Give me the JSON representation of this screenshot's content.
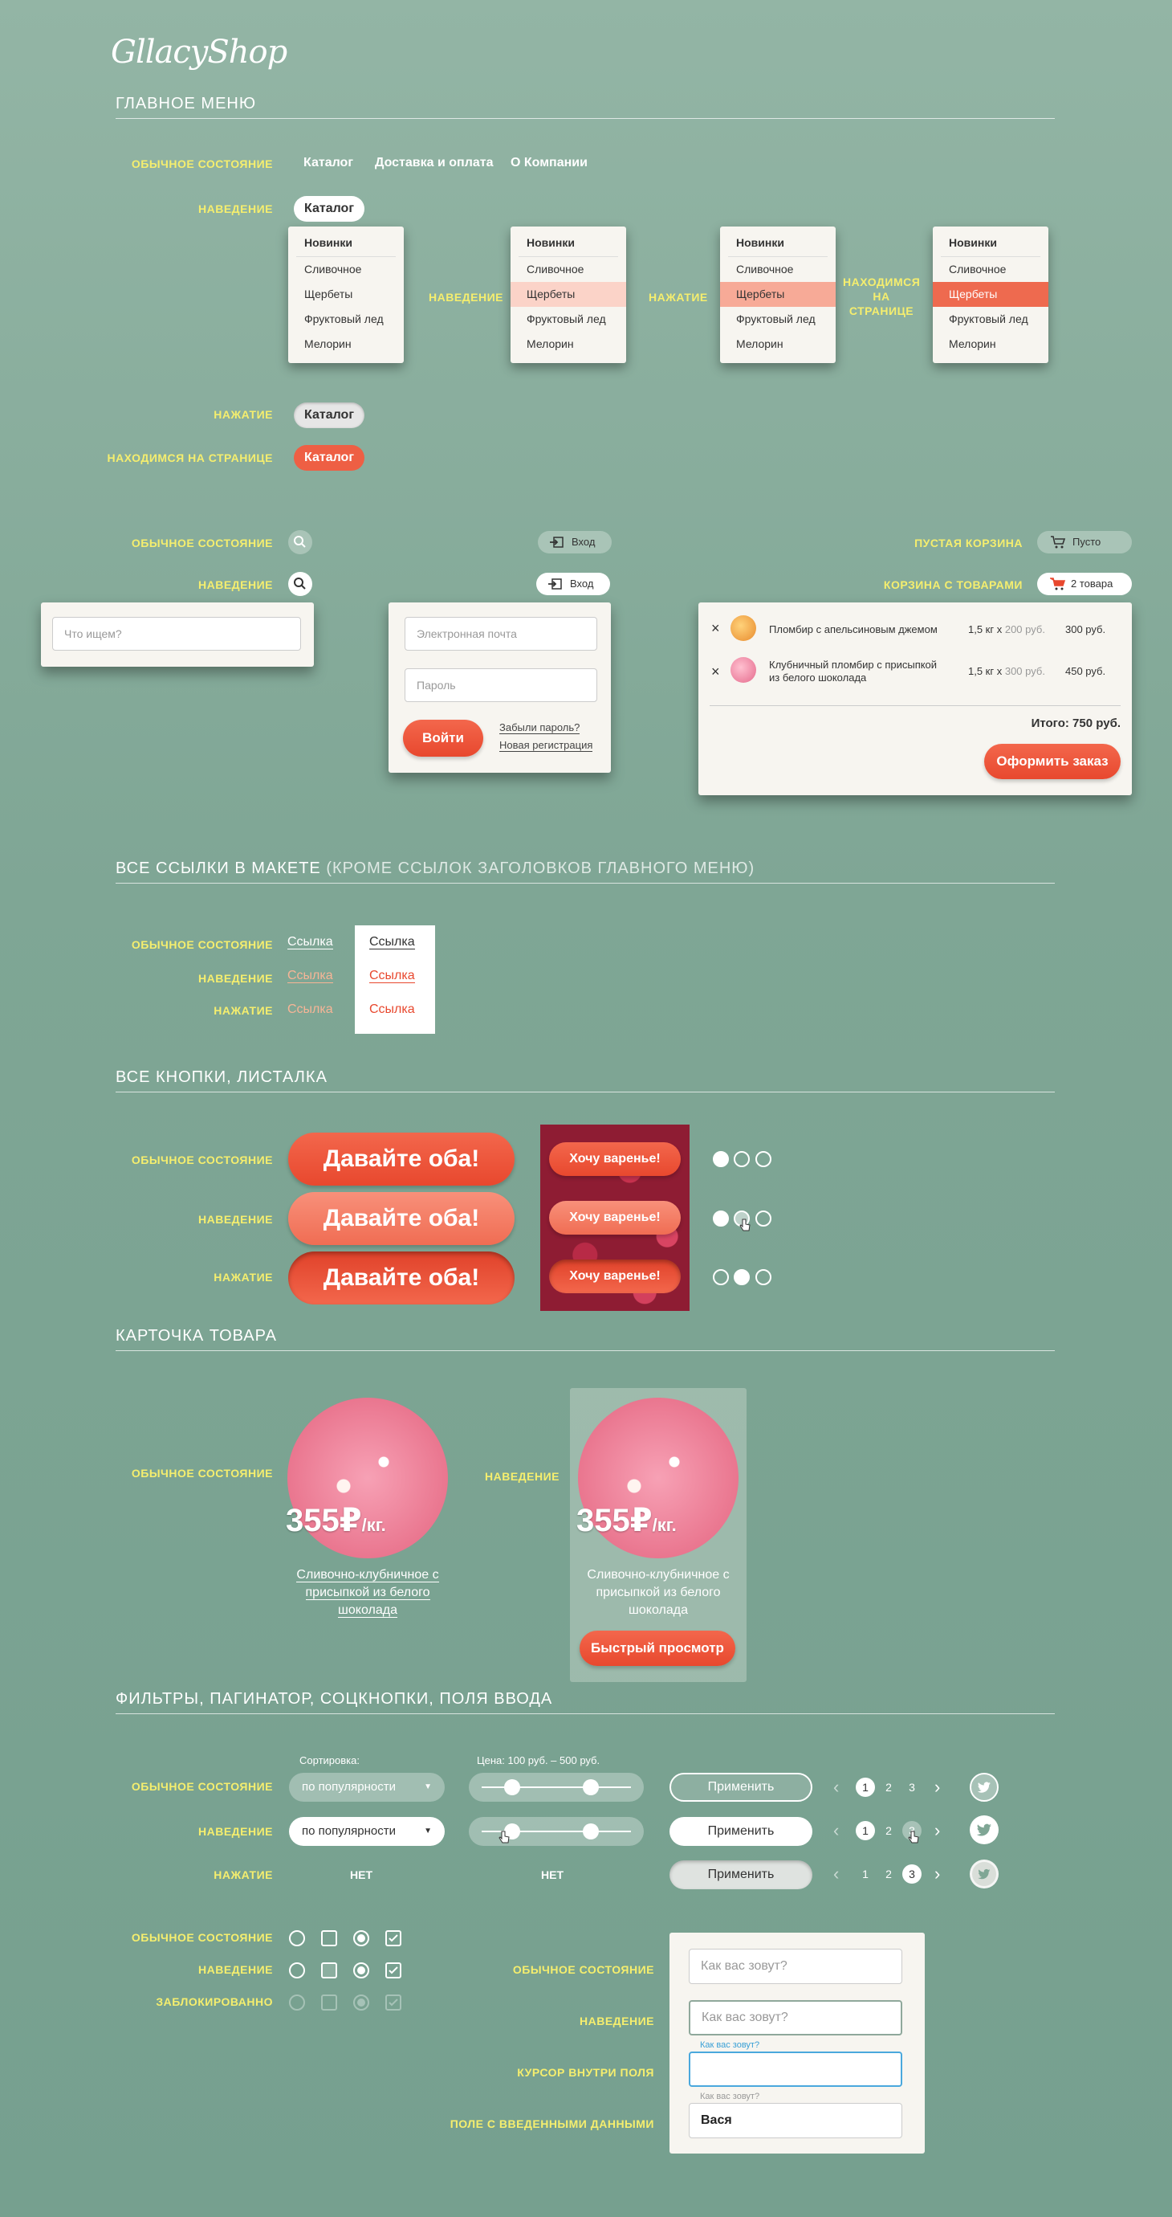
{
  "logo": "GllacyShop",
  "sections": {
    "main_menu": "ГЛАВНОЕ МЕНЮ",
    "links_main": "ВСЕ ССЫЛКИ В МАКЕТЕ",
    "links_sub": "(КРОМЕ ССЫЛОК ЗАГОЛОВКОВ ГЛАВНОГО МЕНЮ)",
    "buttons": "ВСЕ КНОПКИ, ЛИСТАЛКА",
    "card": "КАРТОЧКА ТОВАРА",
    "filters": "ФИЛЬТРЫ, ПАГИНАТОР, СОЦКНОПКИ, ПОЛЯ ВВОДА"
  },
  "states": {
    "normal": "ОБЫЧНОЕ СОСТОЯНИЕ",
    "hover": "НАВЕДЕНИЕ",
    "press": "НАЖАТИЕ",
    "current": "НАХОДИМСЯ НА СТРАНИЦЕ",
    "current_multiline": [
      "НАХОДИМСЯ",
      "НА",
      "СТРАНИЦЕ"
    ],
    "disabled": "ЗАБЛОКИРОВАННО",
    "cursor_in": "КУРСОР ВНУТРИ ПОЛЯ",
    "filled": "ПОЛЕ С ВВЕДЕННЫМИ ДАННЫМИ",
    "empty_cart": "ПУСТАЯ КОРЗИНА",
    "cart_with_items": "КОРЗИНА С ТОВАРАМИ",
    "none": "НЕТ"
  },
  "nav": {
    "catalog": "Каталог",
    "delivery": "Доставка и оплата",
    "about": "О Компании"
  },
  "dropdown": {
    "head": "Новинки",
    "items": [
      "Сливочное",
      "Щербеты",
      "Фруктовый лед",
      "Мелорин"
    ]
  },
  "search": {
    "placeholder": "Что ищем?"
  },
  "login": {
    "label": "Вход",
    "email": "Электронная почта",
    "password": "Пароль",
    "submit": "Войти",
    "forgot": "Забыли пароль?",
    "register": "Новая регистрация"
  },
  "cart": {
    "empty": "Пусто",
    "full": "2 товара",
    "items": [
      {
        "name": "Пломбир с апельсиновым джемом",
        "qty": "1,5 кг х ",
        "unit": "200 руб.",
        "sum": "300 руб."
      },
      {
        "name_l1": "Клубничный пломбир с присыпкой",
        "name_l2": "из белого шоколада",
        "qty": "1,5 кг х ",
        "unit": "300 руб.",
        "sum": "450 руб."
      }
    ],
    "total": "Итого: 750 руб.",
    "checkout": "Оформить заказ",
    "remove": "×"
  },
  "links": {
    "text": "Ссылка"
  },
  "buttons": {
    "big": "Давайте оба!",
    "jam": "Хочу варенье!"
  },
  "product": {
    "price": "355₽",
    "unit": "/кг.",
    "name_l1": "Сливочно-клубничное с",
    "name_l2": "присыпкой из белого",
    "name_l3": "шоколада",
    "quick": "Быстрый просмотр"
  },
  "filters": {
    "sort_label": "Сортировка:",
    "sort_value": "по популярности",
    "price_label": "Цена: 100 руб. – 500 руб.",
    "apply": "Применить",
    "pages": [
      "1",
      "2",
      "3"
    ],
    "prev": "‹",
    "next": "›"
  },
  "form": {
    "placeholder": "Как вас зовут?",
    "float_label": "Как вас зовут?",
    "filled_value": "Вася"
  },
  "colors": {
    "accent": "#ee5335",
    "label_yellow": "#f5ee6e",
    "background": "#7fa695"
  }
}
